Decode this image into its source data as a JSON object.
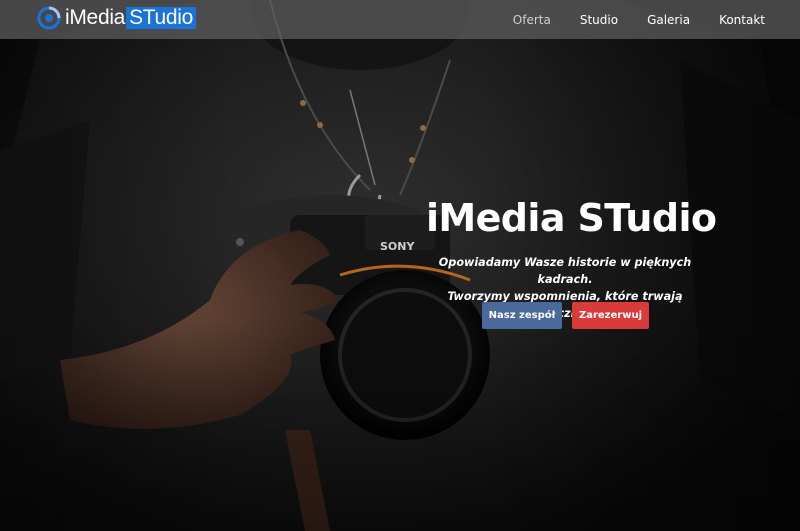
{
  "brand": {
    "name_part1": "iMedia",
    "name_part2": "STudio",
    "logo_icon": "circle-swirl-icon",
    "highlight_color": "#1a73d8"
  },
  "nav": {
    "items": [
      {
        "label": "Oferta"
      },
      {
        "label": "Studio"
      },
      {
        "label": "Galeria"
      },
      {
        "label": "Kontakt"
      }
    ]
  },
  "hero": {
    "title": "iMedia STudio",
    "subtitle_line1": "Opowiadamy Wasze historie w pięknych kadrach.",
    "subtitle_line2": "Tworzymy wspomnienia, które trwają wiecznie.",
    "camera_brand": "SONY",
    "buttons": {
      "team_label": "Nasz zespół",
      "book_label": "Zarezerwuj"
    }
  },
  "colors": {
    "team_button": "#4a6a9c",
    "book_button": "#d93a3a",
    "navbar": "rgba(95,95,95,0.72)"
  }
}
